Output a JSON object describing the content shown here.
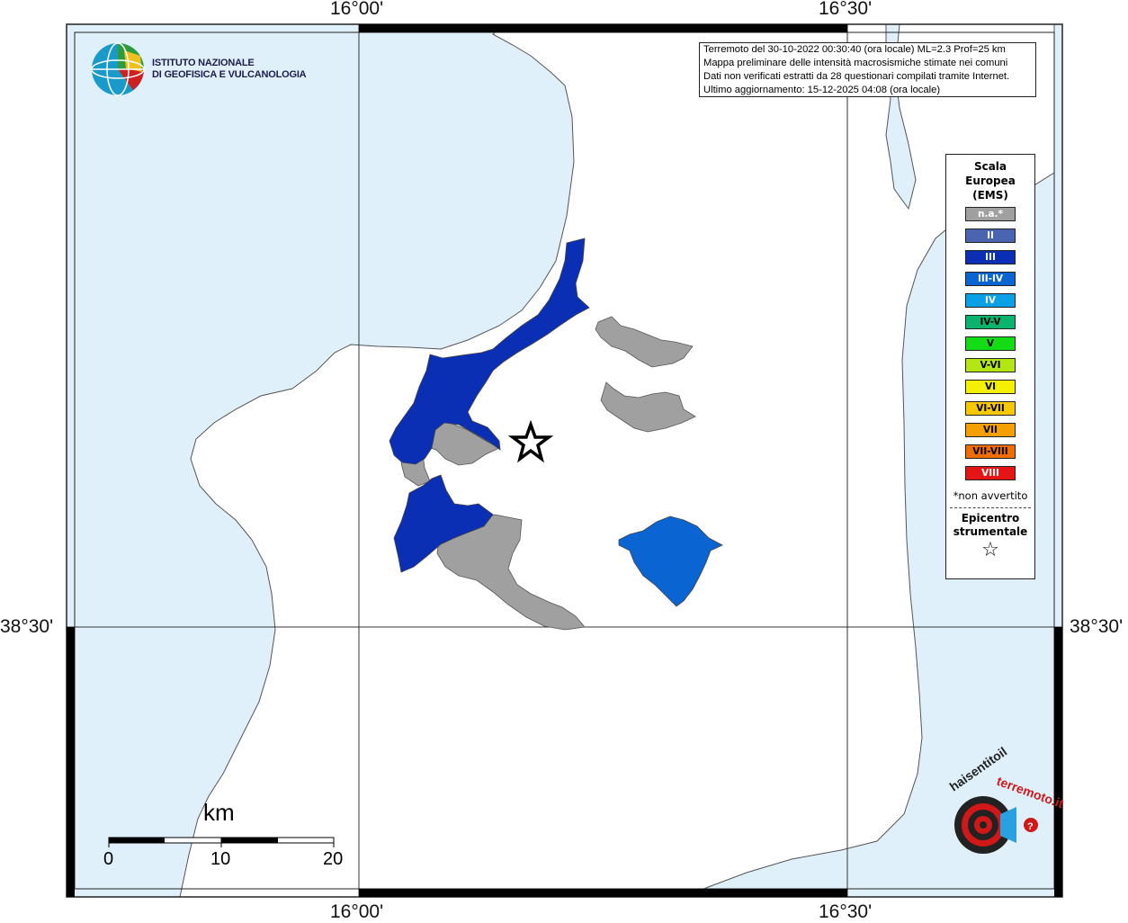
{
  "coords": {
    "top_left": "16°00'",
    "top_right": "16°30'",
    "bottom_left": "16°00'",
    "bottom_right": "16°30'",
    "left": "38°30'",
    "right": "38°30'"
  },
  "institute": {
    "line1": "ISTITUTO NAZIONALE",
    "line2": "DI GEOFISICA E VULCANOLOGIA"
  },
  "info": {
    "line1": "Terremoto del 30-10-2022 00:30:40 (ora locale) ML=2.3 Prof=25 km",
    "line2": "Mappa preliminare delle intensità macrosismiche stimate nei comuni",
    "line3": "Dati non verificati estratti da 28 questionari compilati tramite Internet.",
    "line4": "Ultimo aggiornamento: 15-12-2025 04:08 (ora locale)"
  },
  "legend": {
    "title1": "Scala",
    "title2": "Europea",
    "title3": "(EMS)",
    "items": [
      {
        "label": "n.a.*",
        "color": "#a0a0a0"
      },
      {
        "label": "II",
        "color": "#4a64b0"
      },
      {
        "label": "III",
        "color": "#0a2fb4"
      },
      {
        "label": "III-IV",
        "color": "#0a64d2"
      },
      {
        "label": "IV",
        "color": "#0aa0e6"
      },
      {
        "label": "IV-V",
        "color": "#0ab46e"
      },
      {
        "label": "V",
        "color": "#14dc14"
      },
      {
        "label": "V-VI",
        "color": "#b4e614"
      },
      {
        "label": "VI",
        "color": "#f5f000"
      },
      {
        "label": "VI-VII",
        "color": "#f5c800"
      },
      {
        "label": "VII",
        "color": "#f5a000"
      },
      {
        "label": "VII-VIII",
        "color": "#f06e00"
      },
      {
        "label": "VIII",
        "color": "#e61414"
      }
    ],
    "note": "*non avvertito",
    "epi1": "Epicentro",
    "epi2": "strumentale",
    "star": "☆"
  },
  "scale": {
    "unit": "km",
    "ticks": [
      "0",
      "10",
      "20"
    ]
  },
  "logo_hst": {
    "text": "www.haisentitoilterremoto.it"
  },
  "colors": {
    "sea": "#dff0fb",
    "land": "#ffffff",
    "na": "#a0a0a0",
    "intensity_III": "#0a2fb4",
    "intensity_III_IV": "#0a64d2"
  }
}
